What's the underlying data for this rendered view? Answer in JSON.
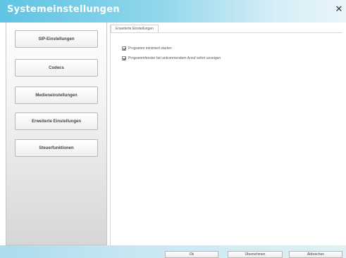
{
  "window": {
    "title": "Systemeinstellungen",
    "close_glyph": "✕"
  },
  "sidebar": {
    "items": [
      {
        "label": "SIP-Einstellungen"
      },
      {
        "label": "Codecs"
      },
      {
        "label": "Medieneinstellungen"
      },
      {
        "label": "Erweiterte Einstellungen"
      },
      {
        "label": "Steuerfunktionen"
      }
    ]
  },
  "content": {
    "tab_label": "Erweiterte Einstellungen",
    "options": [
      {
        "label": "Programm minimiert starten",
        "checked": true
      },
      {
        "label": "Programmfenster bei ankommendem Anruf sofort anzeigen",
        "checked": true
      }
    ]
  },
  "footer": {
    "ok_label": "Ok",
    "apply_label": "Übernehmen",
    "cancel_label": "Abbrechen"
  },
  "colors": {
    "titlebar_accent": "#5fc4e3",
    "footer_accent": "#a9dced"
  }
}
